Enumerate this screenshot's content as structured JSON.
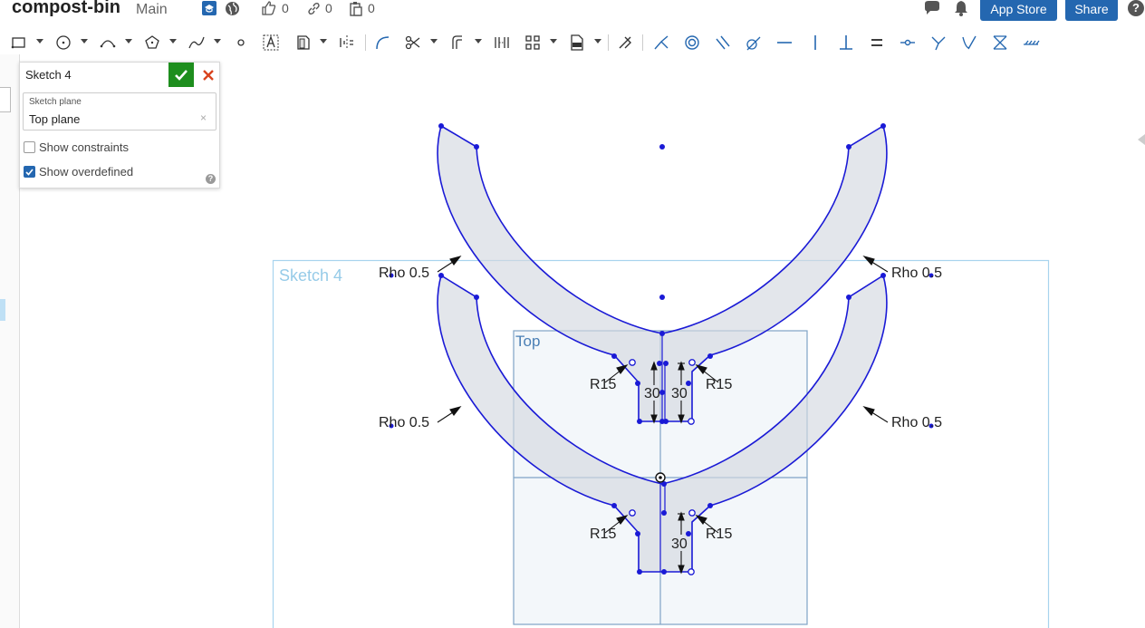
{
  "header": {
    "doc_title": "compost-bin",
    "branch": "Main",
    "likes": "0",
    "links": "0",
    "copies": "0",
    "app_store_label": "App Store",
    "share_label": "Share",
    "help_glyph": "?"
  },
  "toolbar": {
    "tools": [
      "rectangle-tool",
      "circle-tool",
      "arc-tool",
      "polygon-tool",
      "spline-tool",
      "point-tool",
      "text-tool",
      "construction-tool",
      "mirror-tool",
      "fillet-tool",
      "trim-tool",
      "offset-tool",
      "pattern-tool",
      "linear-pattern-tool",
      "dxf-import-tool",
      "dimension-tool",
      "coincident-tool",
      "concentric-tool",
      "parallel-tool",
      "tangent-tool",
      "horizontal-tool",
      "vertical-tool",
      "perpendicular-tool",
      "equal-tool",
      "midpoint-tool",
      "normal-tool",
      "pierce-tool",
      "symmetric-tool",
      "fix-tool"
    ]
  },
  "sketch_panel": {
    "title": "Sketch 4",
    "plane_label": "Sketch plane",
    "plane_value": "Top plane",
    "clear_glyph": "×",
    "show_constraints_label": "Show constraints",
    "show_constraints": false,
    "show_overdefined_label": "Show overdefined",
    "show_overdefined": true
  },
  "canvas": {
    "sketch_label": "Sketch 4",
    "plane_label": "Top",
    "dim_rho": "Rho 0.5",
    "dim_radius": "R15",
    "dim_height": "30"
  }
}
